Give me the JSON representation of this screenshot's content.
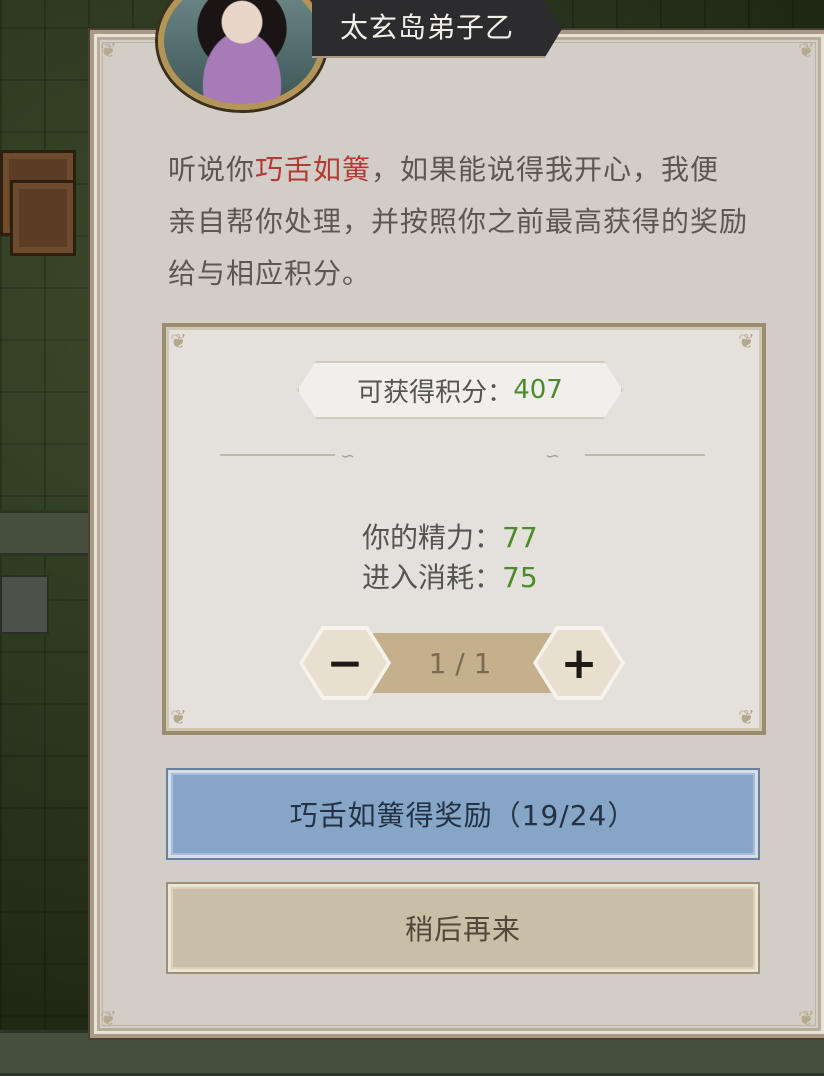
{
  "dialog": {
    "speaker_name": "太玄岛弟子乙",
    "story_prefix": "听说你",
    "story_highlight": "巧舌如簧",
    "story_suffix": "，如果能说得我开心，我便亲自帮你处理，并按照你之前最高获得的奖励给与相应积分。"
  },
  "panel": {
    "reward_label": "可获得积分：",
    "reward_value": "407",
    "energy_label": "你的精力：",
    "energy_value": "77",
    "cost_label": "进入消耗：",
    "cost_value": "75",
    "stepper": {
      "minus": "−",
      "count": "1 / 1",
      "plus": "+"
    }
  },
  "buttons": {
    "primary_label": "巧舌如簧得奖励（19/24）",
    "secondary_label": "稍后再来"
  },
  "colors": {
    "accent_green": "#4f8a2a",
    "highlight_red": "#b13a33",
    "primary_button": "#86a5c7"
  }
}
